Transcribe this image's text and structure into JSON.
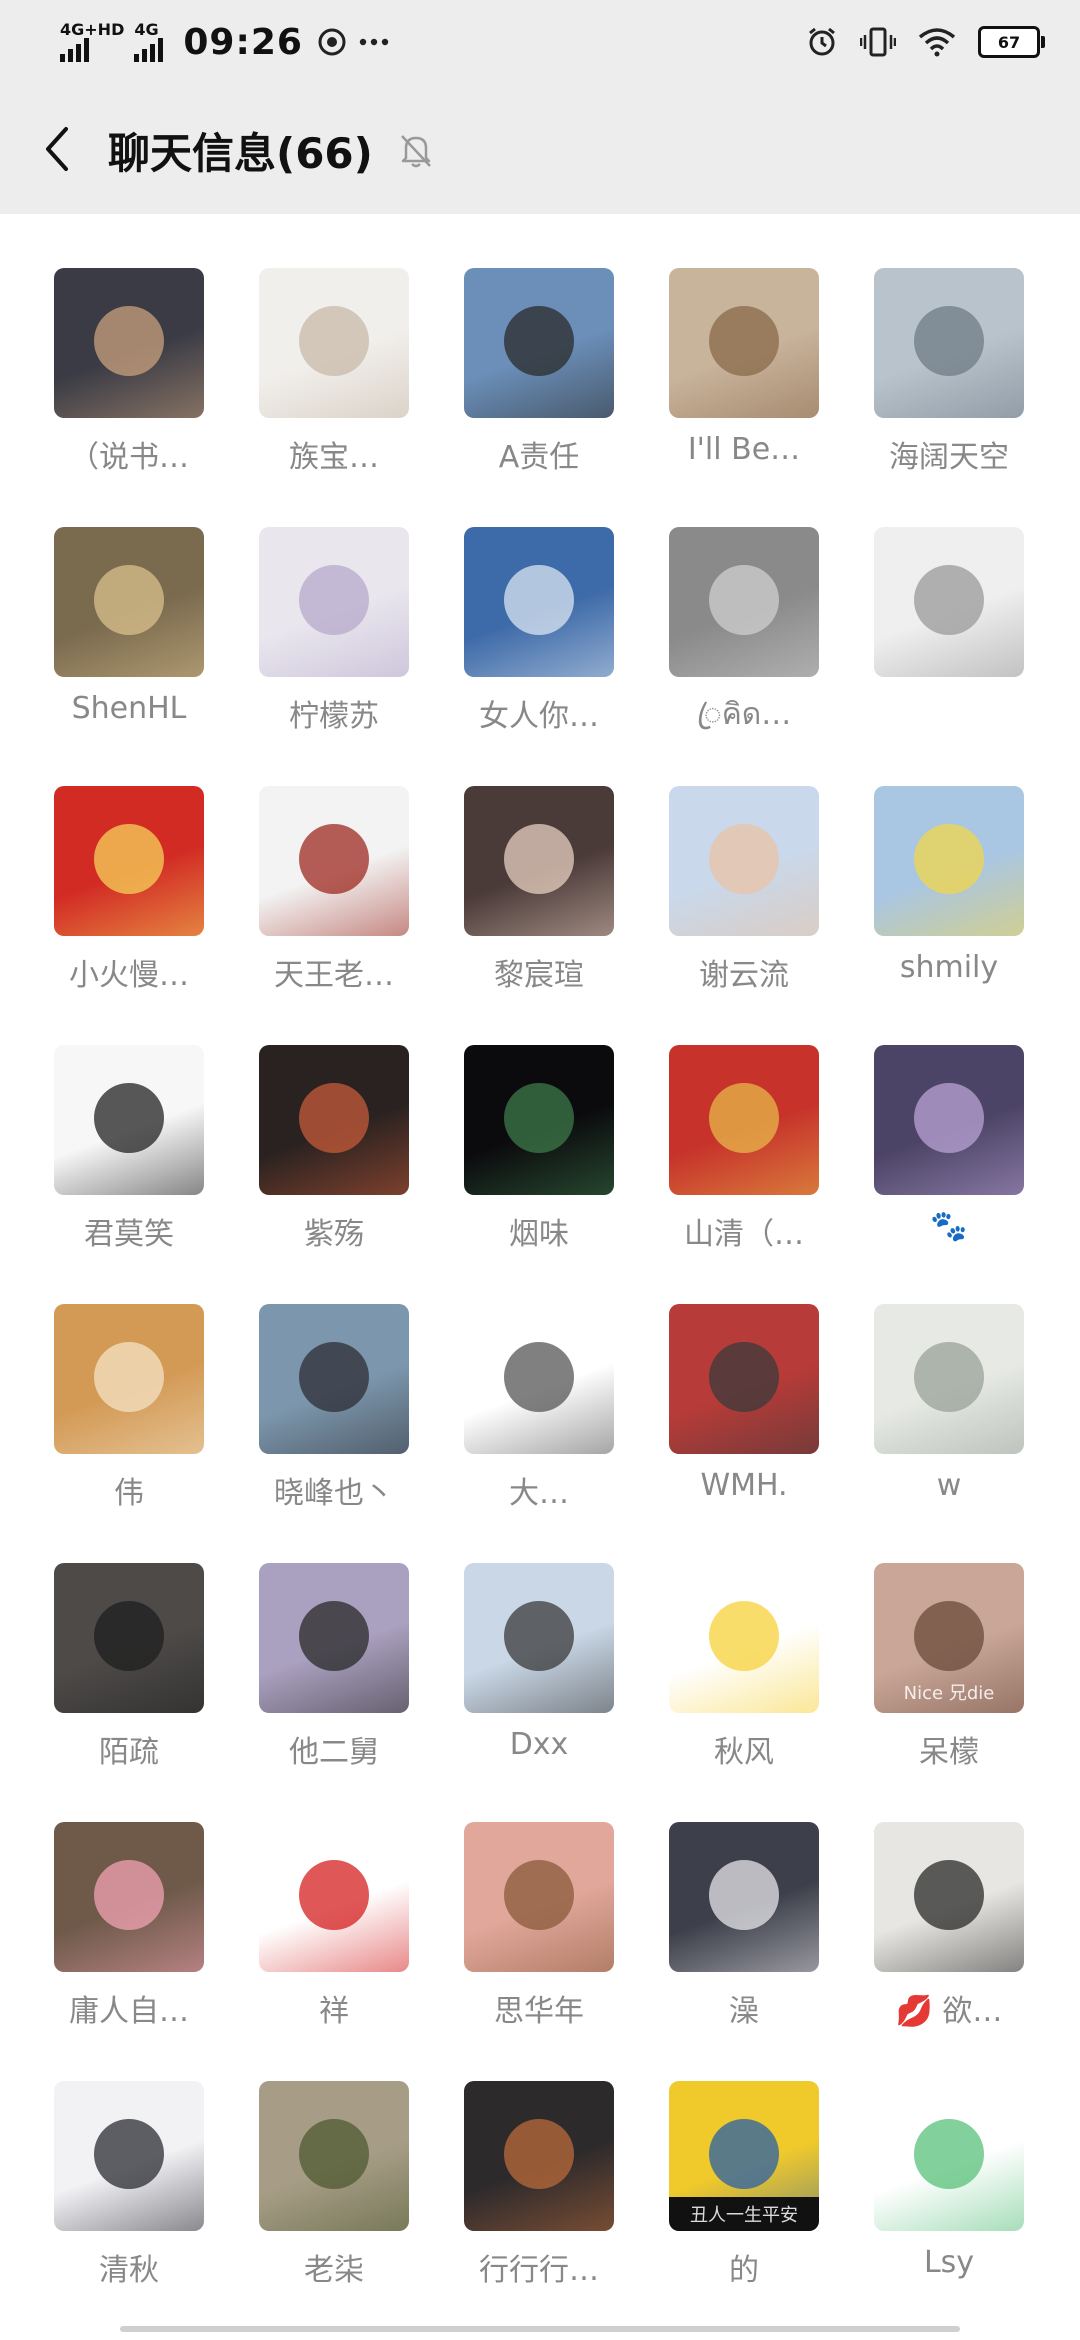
{
  "status": {
    "net1": "4G+HD",
    "net2": "4G",
    "time": "09:26",
    "battery": "67",
    "icons": [
      "settings-circle-icon",
      "more-dots-icon",
      "alarm-icon",
      "vibrate-icon",
      "wifi-icon",
      "battery-icon"
    ]
  },
  "header": {
    "title": "聊天信息(66)",
    "icons": [
      "back-chevron-icon",
      "mute-bell-icon"
    ]
  },
  "members": [
    {
      "name": "（说书…",
      "bg": "#3a3b45",
      "accent": "#c9a27e"
    },
    {
      "name": "族宝…",
      "bg": "#f1efec",
      "accent": "#c8b9a8"
    },
    {
      "name": "A责任",
      "bg": "#6b8fb9",
      "accent": "#2b2b2b"
    },
    {
      "name": "I'll Be…",
      "bg": "#c8b39b",
      "accent": "#8a6a4a"
    },
    {
      "name": "海阔天空",
      "bg": "#b9c3cc",
      "accent": "#6f7b86"
    },
    {
      "name": "ShenHL",
      "bg": "#7a6a4e",
      "accent": "#d9c08c"
    },
    {
      "name": "柠檬苏",
      "bg": "#e9e6ee",
      "accent": "#b7aacb"
    },
    {
      "name": "女人你…",
      "bg": "#3d6aa8",
      "accent": "#dbe6f2"
    },
    {
      "name": "ꦿคิด…",
      "bg": "#8a8a8a",
      "accent": "#cfcfcf"
    },
    {
      "name": "",
      "bg": "#efefef",
      "accent": "#9a9a9a"
    },
    {
      "name": "小火慢…",
      "bg": "#d22b24",
      "accent": "#f5d15a"
    },
    {
      "name": "天王老…",
      "bg": "#f3f3f3",
      "accent": "#9d2a20"
    },
    {
      "name": "黎宸瑄",
      "bg": "#4a3a38",
      "accent": "#e8cfc0"
    },
    {
      "name": "谢云流",
      "bg": "#c9d8ea",
      "accent": "#e9c3a5"
    },
    {
      "name": "shmily",
      "bg": "#a9c6e3",
      "accent": "#f2d64b"
    },
    {
      "name": "君莫笑",
      "bg": "#f7f7f7",
      "accent": "#222222"
    },
    {
      "name": "紫殇",
      "bg": "#2a2220",
      "accent": "#c65b3a"
    },
    {
      "name": "烟味",
      "bg": "#0b0b0e",
      "accent": "#3e7a4a"
    },
    {
      "name": "山清（…",
      "bg": "#c7332b",
      "accent": "#e7b84a"
    },
    {
      "name": "🐾",
      "bg": "#4c4466",
      "accent": "#b9a3d6"
    },
    {
      "name": "伟",
      "bg": "#d39a56",
      "accent": "#f3e2c4"
    },
    {
      "name": "晓峰也丶",
      "bg": "#7c97ad",
      "accent": "#2e2e35"
    },
    {
      "name": "大…",
      "bg": "#ffffff",
      "accent": "#555555"
    },
    {
      "name": "WMH.",
      "bg": "#b73b38",
      "accent": "#3b3b3b"
    },
    {
      "name": "w",
      "bg": "#e6e9e4",
      "accent": "#9aa29a"
    },
    {
      "name": "陌疏",
      "bg": "#4d4a48",
      "accent": "#1f1f1f"
    },
    {
      "name": "他二舅",
      "bg": "#aaa0bf",
      "accent": "#2a2a2a"
    },
    {
      "name": "Dxx",
      "bg": "#c9d7e6",
      "accent": "#3a3a3a"
    },
    {
      "name": "秋风",
      "bg": "#ffffff",
      "accent": "#f6d23a"
    },
    {
      "name": "呆檬",
      "bg": "#c9a698",
      "accent": "#6b4a3a"
    },
    {
      "name": "庸人自…",
      "bg": "#6f5a4a",
      "accent": "#f2a3b3"
    },
    {
      "name": "祥",
      "bg": "#ffffff",
      "accent": "#d41f1f"
    },
    {
      "name": "思华年",
      "bg": "#e0a79a",
      "accent": "#8a5a3a"
    },
    {
      "name": "澡",
      "bg": "#3d3f4a",
      "accent": "#e6e6ea"
    },
    {
      "name": "💋 欲…",
      "bg": "#e8e6e2",
      "accent": "#2a2a2a"
    },
    {
      "name": "清秋",
      "bg": "#f2f2f5",
      "accent": "#2b2b33"
    },
    {
      "name": "老柒",
      "bg": "#a79d86",
      "accent": "#4f5a32"
    },
    {
      "name": "行行行…",
      "bg": "#2d2a2c",
      "accent": "#b96b3a"
    },
    {
      "name": "的",
      "bg": "#f0c92b",
      "accent": "#2a5fa8"
    },
    {
      "name": "Lsy",
      "bg": "#ffffff",
      "accent": "#58c07a"
    }
  ],
  "avatar_texts": {
    "duck_caption": "Nice 兄die",
    "pikachu_caption": "丑人一生平安"
  }
}
